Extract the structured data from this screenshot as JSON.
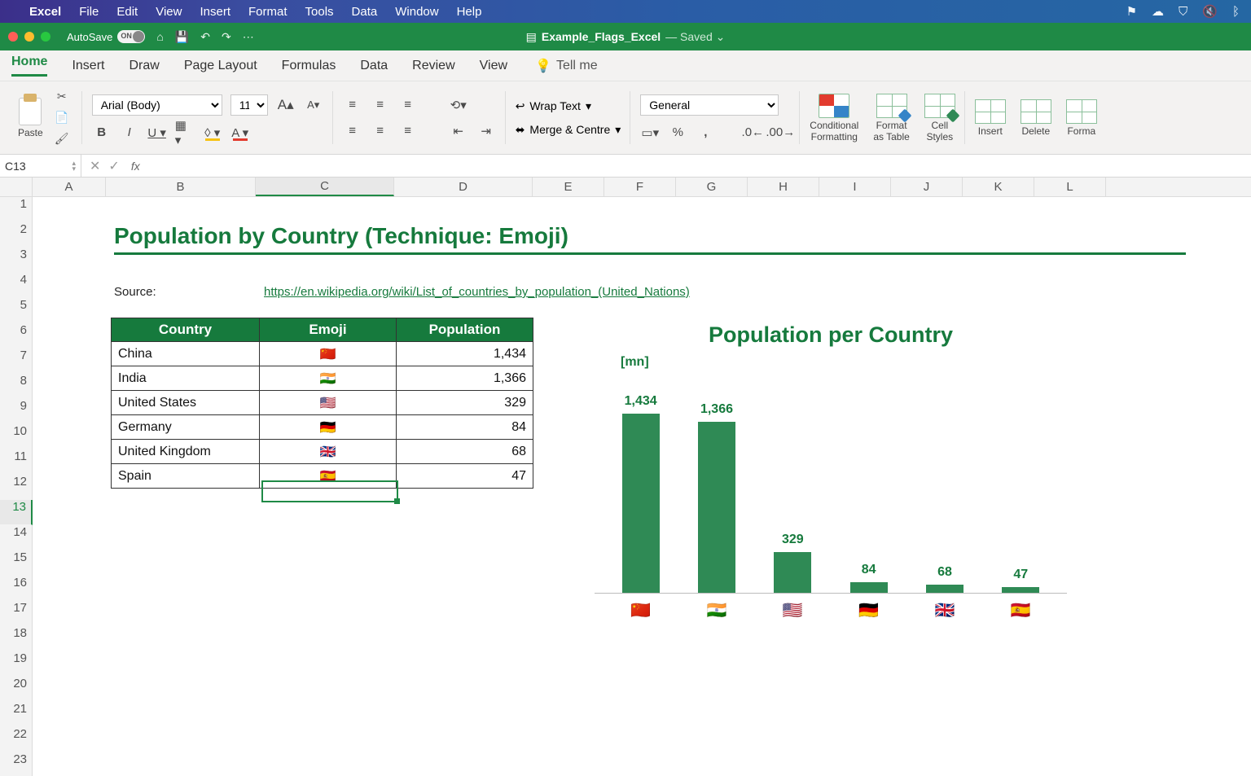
{
  "mac_menu": {
    "app": "Excel",
    "items": [
      "File",
      "Edit",
      "View",
      "Insert",
      "Format",
      "Tools",
      "Data",
      "Window",
      "Help"
    ]
  },
  "titlebar": {
    "autosave_label": "AutoSave",
    "autosave_state": "ON",
    "doc_name": "Example_Flags_Excel",
    "status": "Saved"
  },
  "ribbon_tabs": [
    "Home",
    "Insert",
    "Draw",
    "Page Layout",
    "Formulas",
    "Data",
    "Review",
    "View"
  ],
  "ribbon_tellme": "Tell me",
  "ribbon": {
    "paste": "Paste",
    "font": "Arial (Body)",
    "size": "11",
    "wrap": "Wrap Text",
    "merge": "Merge & Centre",
    "numfmt": "General",
    "cond_fmt": "Conditional\nFormatting",
    "as_table": "Format\nas Table",
    "cell_styles": "Cell\nStyles",
    "insert": "Insert",
    "delete": "Delete",
    "format": "Forma"
  },
  "formula_bar": {
    "cell": "C13",
    "fx": ""
  },
  "columns": [
    "A",
    "B",
    "C",
    "D",
    "E",
    "F",
    "G",
    "H",
    "I",
    "J",
    "K",
    "L"
  ],
  "rows": [
    "1",
    "2",
    "3",
    "4",
    "5",
    "6",
    "7",
    "8",
    "9",
    "10",
    "11",
    "12",
    "13",
    "14",
    "15",
    "16",
    "17",
    "18",
    "19",
    "20",
    "21",
    "22",
    "23"
  ],
  "content": {
    "title": "Population by Country (Technique: Emoji)",
    "source_label": "Source:",
    "source_link": "https://en.wikipedia.org/wiki/List_of_countries_by_population_(United_Nations)",
    "headers": {
      "country": "Country",
      "emoji": "Emoji",
      "population": "Population"
    },
    "rows": [
      {
        "country": "China",
        "flag": "🇨🇳",
        "pop": "1,434"
      },
      {
        "country": "India",
        "flag": "🇮🇳",
        "pop": "1,366"
      },
      {
        "country": "United States",
        "flag": "🇺🇸",
        "pop": "329"
      },
      {
        "country": "Germany",
        "flag": "🇩🇪",
        "pop": "84"
      },
      {
        "country": "United Kingdom",
        "flag": "🇬🇧",
        "pop": "68"
      },
      {
        "country": "Spain",
        "flag": "🇪🇸",
        "pop": "47"
      }
    ]
  },
  "chart_data": {
    "type": "bar",
    "title": "Population per Country",
    "unit": "[mn]",
    "categories": [
      "🇨🇳",
      "🇮🇳",
      "🇺🇸",
      "🇩🇪",
      "🇬🇧",
      "🇪🇸"
    ],
    "values": [
      1434,
      1366,
      329,
      84,
      68,
      47
    ],
    "labels": [
      "1,434",
      "1,366",
      "329",
      "84",
      "68",
      "47"
    ],
    "ylim": [
      0,
      1434
    ]
  }
}
